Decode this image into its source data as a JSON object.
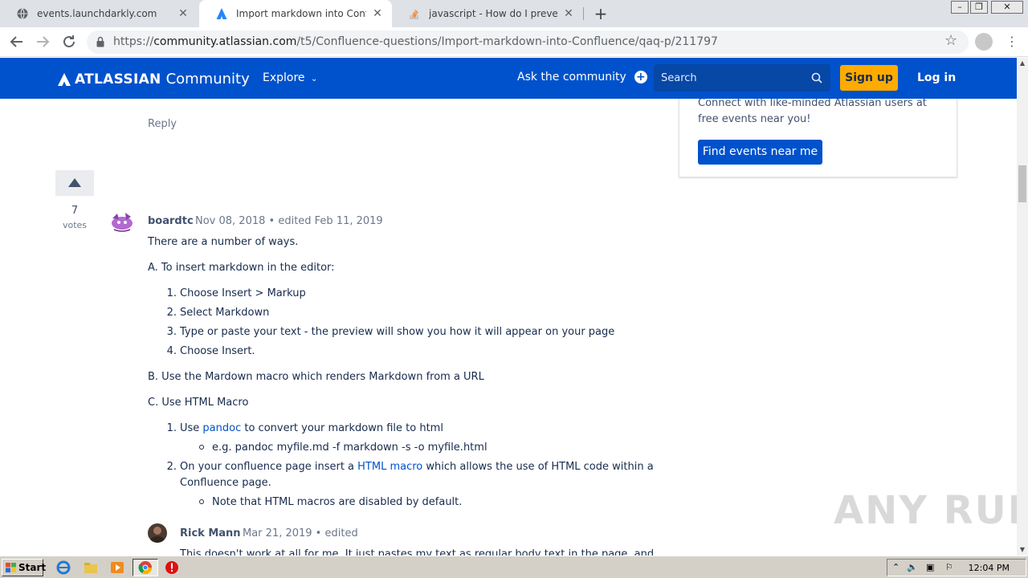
{
  "browser": {
    "tabs": [
      {
        "title": "events.launchdarkly.com",
        "icon": "globe-icon"
      },
      {
        "title": "Import markdown into Confluence",
        "icon": "atlassian-icon"
      },
      {
        "title": "javascript - How do I prevent Google",
        "icon": "stackoverflow-icon"
      }
    ],
    "close_glyph": "✕",
    "new_tab": "+",
    "url_prefix": "https://",
    "url_host": "community.atlassian.com",
    "url_path": "/t5/Confluence-questions/Import-markdown-into-Confluence/qaq-p/211797"
  },
  "header": {
    "logo_text": "ATLASSIAN",
    "logo_suffix": "Community",
    "explore": "Explore",
    "ask": "Ask the community",
    "search_placeholder": "Search",
    "signup": "Sign up",
    "login": "Log in",
    "brand_color": "#0052cc"
  },
  "sidebar": {
    "description": "Connect with like-minded Atlassian users at free events near you!",
    "button": "Find events near me"
  },
  "thread": {
    "reply_label": "Reply",
    "answer": {
      "votes": "7",
      "votes_label": "votes",
      "author": "boardtc",
      "meta": "Nov 08, 2018 • edited Feb 11, 2019",
      "intro": "There are a number of ways.",
      "section_a": "A. To insert markdown in the editor:",
      "steps_a": [
        "Choose Insert > Markup",
        "Select Markdown",
        "Type or paste your text - the preview will show you how it will appear on your page",
        "Choose Insert."
      ],
      "section_b": "B. Use the Mardown macro which renders Markdown from a URL",
      "section_c": "C. Use HTML Macro",
      "c1_pre": "Use ",
      "c1_link": "pandoc",
      "c1_post": " to convert your markdown file to html",
      "c1_sub": "e.g.  pandoc myfile.md -f markdown -s -o myfile.html",
      "c2_pre": "On your confluence page insert a ",
      "c2_link": "HTML macro",
      "c2_post": " which allows the use of HTML code within a",
      "c2_line2": "Confluence page.",
      "c2_sub": "Note that HTML macros are disabled by default."
    },
    "comment": {
      "author": "Rick Mann",
      "meta": "Mar 21, 2019 • edited",
      "text": "This doesn't work at all for me. It just pastes my text as regular body text in the page, and"
    }
  },
  "watermark": "ANY RUN",
  "taskbar": {
    "start": "Start",
    "clock": "12:04 PM"
  }
}
